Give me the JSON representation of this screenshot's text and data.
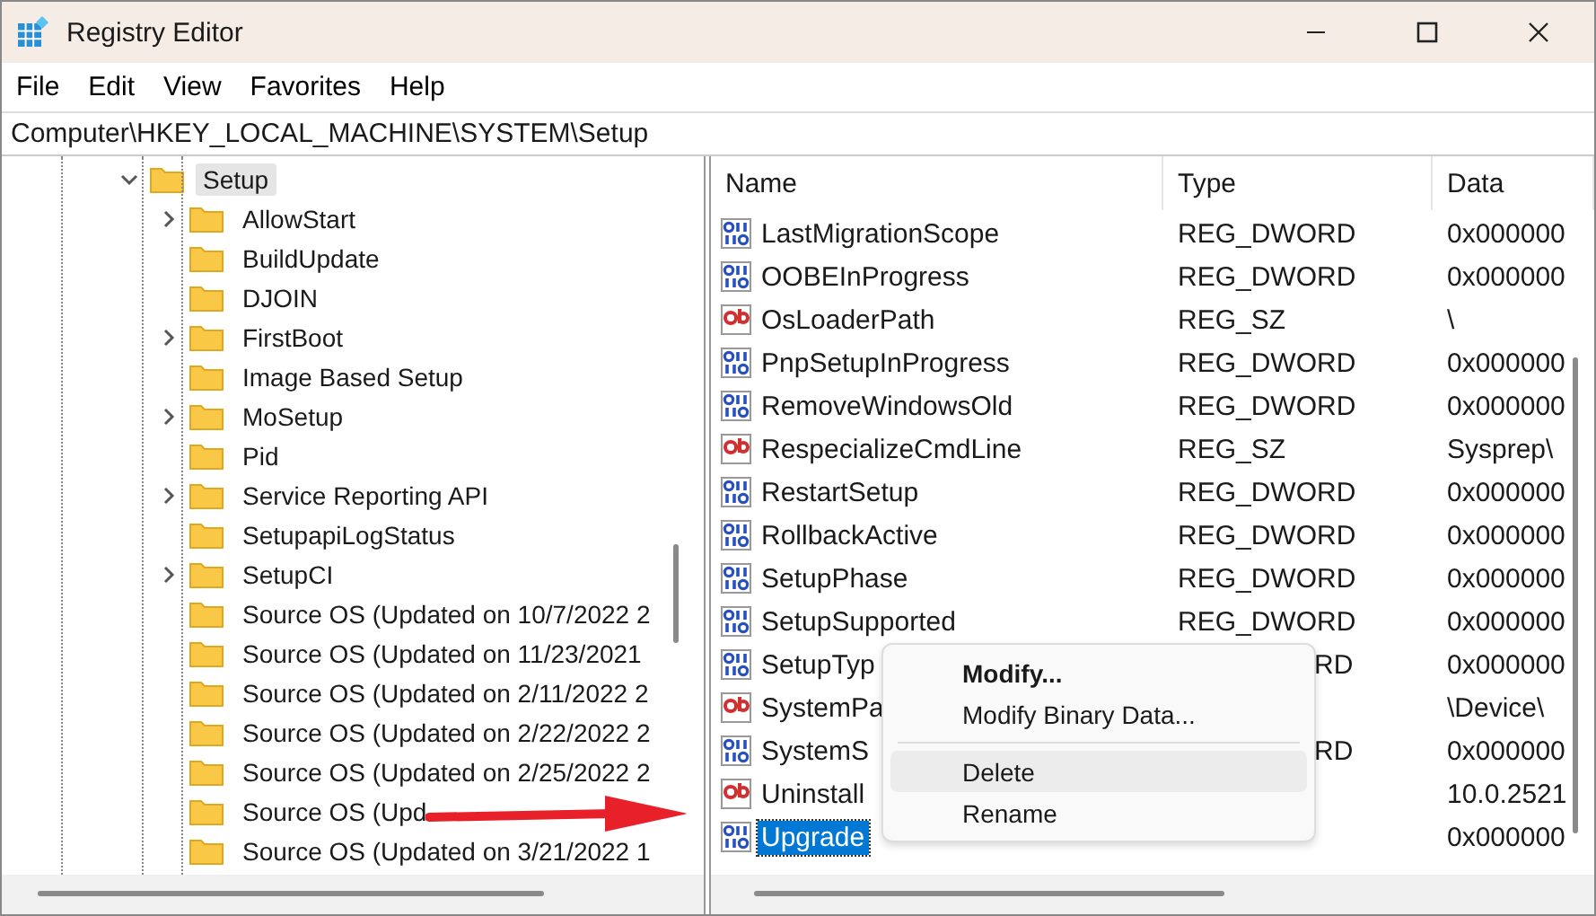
{
  "window": {
    "title": "Registry Editor"
  },
  "menu": [
    "File",
    "Edit",
    "View",
    "Favorites",
    "Help"
  ],
  "address": "Computer\\HKEY_LOCAL_MACHINE\\SYSTEM\\Setup",
  "tree": [
    {
      "label": "Setup",
      "expanded": true,
      "selected": true,
      "has_children": true,
      "children": [
        {
          "label": "AllowStart",
          "has_children": true,
          "selected": false
        },
        {
          "label": "BuildUpdate",
          "has_children": false,
          "selected": false
        },
        {
          "label": "DJOIN",
          "has_children": false,
          "selected": false
        },
        {
          "label": "FirstBoot",
          "has_children": true,
          "selected": false
        },
        {
          "label": "Image Based Setup",
          "has_children": false,
          "selected": false
        },
        {
          "label": "MoSetup",
          "has_children": true,
          "selected": false
        },
        {
          "label": "Pid",
          "has_children": false,
          "selected": false
        },
        {
          "label": "Service Reporting API",
          "has_children": true,
          "selected": false
        },
        {
          "label": "SetupapiLogStatus",
          "has_children": false,
          "selected": false
        },
        {
          "label": "SetupCI",
          "has_children": true,
          "selected": false
        },
        {
          "label": "Source OS (Updated on 10/7/2022 2",
          "has_children": false,
          "selected": false
        },
        {
          "label": "Source OS (Updated on 11/23/2021",
          "has_children": false,
          "selected": false
        },
        {
          "label": "Source OS (Updated on 2/11/2022 2",
          "has_children": false,
          "selected": false
        },
        {
          "label": "Source OS (Updated on 2/22/2022 2",
          "has_children": false,
          "selected": false
        },
        {
          "label": "Source OS (Updated on 2/25/2022 2",
          "has_children": false,
          "selected": false
        },
        {
          "label": "Source OS (Upd",
          "has_children": false,
          "selected": false
        },
        {
          "label": "Source OS (Updated on 3/21/2022 1",
          "has_children": false,
          "selected": false
        }
      ]
    }
  ],
  "columns": [
    "Name",
    "Type",
    "Data"
  ],
  "values": [
    {
      "kind": "dword",
      "name": "LastMigrationScope",
      "type": "REG_DWORD",
      "data": "0x000000",
      "selected": false
    },
    {
      "kind": "dword",
      "name": "OOBEInProgress",
      "type": "REG_DWORD",
      "data": "0x000000",
      "selected": false
    },
    {
      "kind": "sz",
      "name": "OsLoaderPath",
      "type": "REG_SZ",
      "data": "\\",
      "selected": false
    },
    {
      "kind": "dword",
      "name": "PnpSetupInProgress",
      "type": "REG_DWORD",
      "data": "0x000000",
      "selected": false
    },
    {
      "kind": "dword",
      "name": "RemoveWindowsOld",
      "type": "REG_DWORD",
      "data": "0x000000",
      "selected": false
    },
    {
      "kind": "sz",
      "name": "RespecializeCmdLine",
      "type": "REG_SZ",
      "data": "Sysprep\\",
      "selected": false
    },
    {
      "kind": "dword",
      "name": "RestartSetup",
      "type": "REG_DWORD",
      "data": "0x000000",
      "selected": false
    },
    {
      "kind": "dword",
      "name": "RollbackActive",
      "type": "REG_DWORD",
      "data": "0x000000",
      "selected": false
    },
    {
      "kind": "dword",
      "name": "SetupPhase",
      "type": "REG_DWORD",
      "data": "0x000000",
      "selected": false
    },
    {
      "kind": "dword",
      "name": "SetupSupported",
      "type": "REG_DWORD",
      "data": "0x000000",
      "selected": false
    },
    {
      "kind": "dword",
      "name": "SetupTyp",
      "type": "RD",
      "data": "0x000000",
      "selected": false
    },
    {
      "kind": "sz",
      "name": "SystemPa",
      "data": "\\Device\\",
      "selected": false
    },
    {
      "kind": "dword",
      "name": "SystemS",
      "type": "RD",
      "data": "0x000000",
      "selected": false
    },
    {
      "kind": "sz",
      "name": "Uninstall",
      "data": "10.0.2521",
      "selected": false
    },
    {
      "kind": "dword",
      "name": "Upgrade",
      "data": "0x000000",
      "selected": true
    }
  ],
  "context_menu": [
    {
      "label": "Modify...",
      "kind": "default",
      "highlighted": false
    },
    {
      "label": "Modify Binary Data...",
      "kind": "item",
      "highlighted": false
    },
    {
      "kind": "separator"
    },
    {
      "label": "Delete",
      "kind": "item",
      "highlighted": true
    },
    {
      "label": "Rename",
      "kind": "item",
      "highlighted": false
    }
  ]
}
